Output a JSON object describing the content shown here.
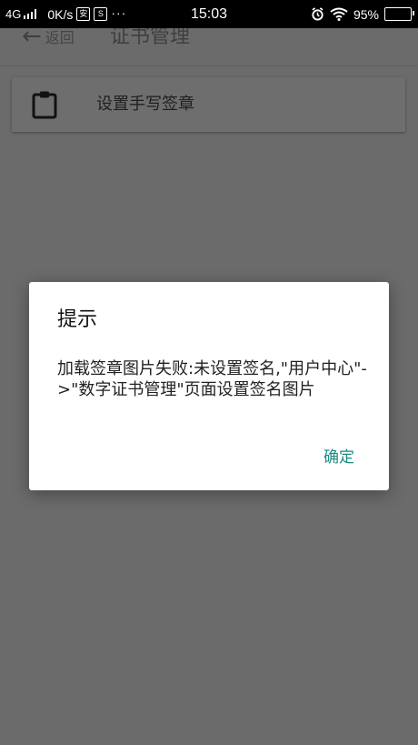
{
  "status_bar": {
    "net_type": "4G",
    "net_speed": "0K/s",
    "app_icon_1": "安",
    "app_icon_2": "S",
    "more": "···",
    "time": "15:03",
    "battery_percent": "95%"
  },
  "app_bar": {
    "back_label": "返回",
    "title": "证书管理"
  },
  "card": {
    "label": "设置手写签章",
    "icon": "clipboard-icon"
  },
  "dialog": {
    "title": "提示",
    "message": "加载签章图片失败:未设置签名,\"用户中心\"->\"数字证书管理\"页面设置签名图片",
    "confirm_label": "确定",
    "accent_color": "#1a8a80"
  },
  "colors": {
    "scrim": "#6b6b6b",
    "status_bar": "#000000",
    "dialog_bg": "#ffffff"
  }
}
